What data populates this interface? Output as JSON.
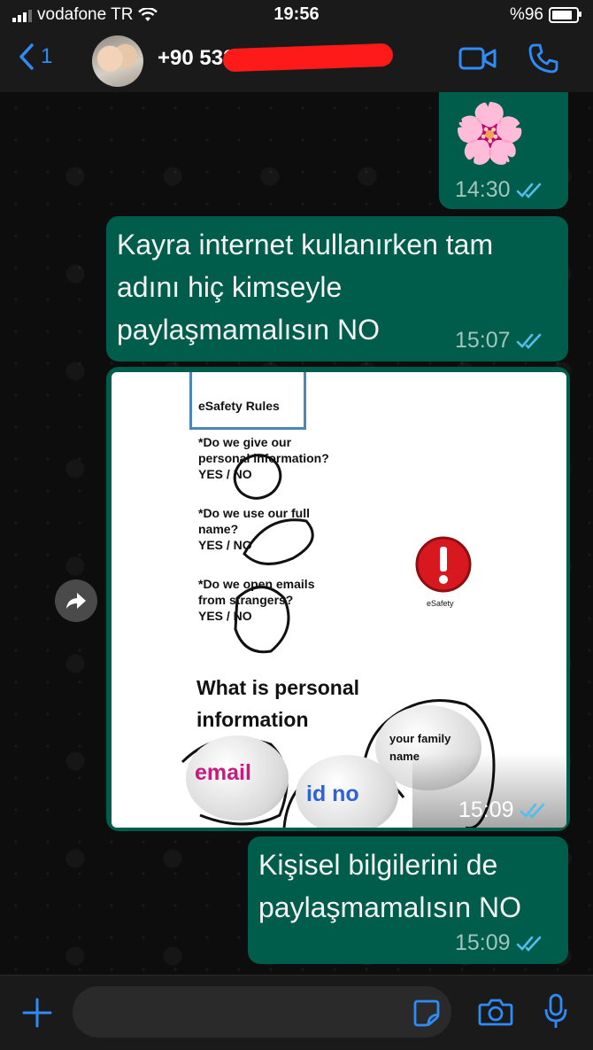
{
  "status": {
    "carrier": "vodafone TR",
    "time": "19:56",
    "battery": "%96"
  },
  "header": {
    "back_count": "1",
    "contact_number": "+90 532"
  },
  "messages": [
    {
      "type": "sticker",
      "emoji": "🌸",
      "time": "14:30"
    },
    {
      "type": "text",
      "lines": [
        "Kayra internet kullanırken tam",
        "adını hiç kimseyle",
        "paylaşmamalısın NO"
      ],
      "time": "15:07"
    },
    {
      "type": "image",
      "time": "15:09"
    },
    {
      "type": "text",
      "lines": [
        "Kişisel bilgilerini de",
        "paylaşmamalısın NO"
      ],
      "time": "15:09"
    }
  ],
  "photo": {
    "header": "eSafety Rules",
    "q1": [
      "*Do we give our",
      "personal information?",
      "YES / NO"
    ],
    "q2": [
      "*Do we use our full",
      "name?",
      "YES / NO"
    ],
    "q3": [
      "*Do we open emails",
      "from strangers?",
      "YES / NO"
    ],
    "logo_label": "eSafety",
    "heading": [
      "What is personal",
      "information"
    ],
    "cloud_email": "email",
    "cloud_id": "id no",
    "cloud_family": [
      "your family",
      "name"
    ]
  },
  "icons": {
    "back": "chevron-left-icon",
    "video": "video-call-icon",
    "phone": "phone-icon",
    "plus": "plus-icon",
    "sticker": "sticker-icon",
    "camera": "camera-icon",
    "mic": "microphone-icon",
    "forward": "forward-icon",
    "read": "double-check-icon"
  },
  "colors": {
    "bubble": "#005c4b",
    "accent": "#2f8cf7",
    "read_ticks": "#53bdeb"
  }
}
